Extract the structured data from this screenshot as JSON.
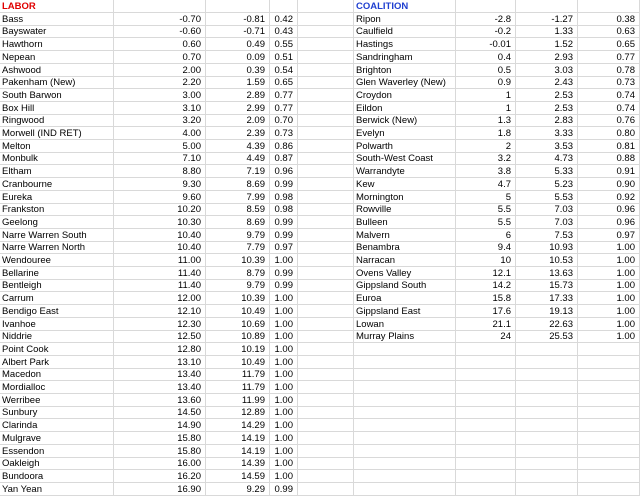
{
  "colors": {
    "labor_header": "#e00000",
    "coalition_header": "#1f3fd0",
    "grid": "#d9d9d9"
  },
  "labor": {
    "header": "LABOR",
    "rows": [
      [
        "Bass",
        "-0.70",
        "-0.81",
        "0.42"
      ],
      [
        "Bayswater",
        "-0.60",
        "-0.71",
        "0.43"
      ],
      [
        "Hawthorn",
        "0.60",
        "0.49",
        "0.55"
      ],
      [
        "Nepean",
        "0.70",
        "0.09",
        "0.51"
      ],
      [
        "Ashwood",
        "2.00",
        "0.39",
        "0.54"
      ],
      [
        "Pakenham (New)",
        "2.20",
        "1.59",
        "0.65"
      ],
      [
        "South Barwon",
        "3.00",
        "2.89",
        "0.77"
      ],
      [
        "Box Hill",
        "3.10",
        "2.99",
        "0.77"
      ],
      [
        "Ringwood",
        "3.20",
        "2.09",
        "0.70"
      ],
      [
        "Morwell (IND RET)",
        "4.00",
        "2.39",
        "0.73"
      ],
      [
        "Melton",
        "5.00",
        "4.39",
        "0.86"
      ],
      [
        "Monbulk",
        "7.10",
        "4.49",
        "0.87"
      ],
      [
        "Eltham",
        "8.80",
        "7.19",
        "0.96"
      ],
      [
        "Cranbourne",
        "9.30",
        "8.69",
        "0.99"
      ],
      [
        "Eureka",
        "9.60",
        "7.99",
        "0.98"
      ],
      [
        "Frankston",
        "10.20",
        "8.59",
        "0.98"
      ],
      [
        "Geelong",
        "10.30",
        "8.69",
        "0.99"
      ],
      [
        "Narre Warren South",
        "10.40",
        "9.79",
        "0.99"
      ],
      [
        "Narre Warren North",
        "10.40",
        "7.79",
        "0.97"
      ],
      [
        "Wendouree",
        "11.00",
        "10.39",
        "1.00"
      ],
      [
        "Bellarine",
        "11.40",
        "8.79",
        "0.99"
      ],
      [
        "Bentleigh",
        "11.40",
        "9.79",
        "0.99"
      ],
      [
        "Carrum",
        "12.00",
        "10.39",
        "1.00"
      ],
      [
        "Bendigo East",
        "12.10",
        "10.49",
        "1.00"
      ],
      [
        "Ivanhoe",
        "12.30",
        "10.69",
        "1.00"
      ],
      [
        "Niddrie",
        "12.50",
        "10.89",
        "1.00"
      ],
      [
        "Point Cook",
        "12.80",
        "10.19",
        "1.00"
      ],
      [
        "Albert Park",
        "13.10",
        "10.49",
        "1.00"
      ],
      [
        "Macedon",
        "13.40",
        "11.79",
        "1.00"
      ],
      [
        "Mordialloc",
        "13.40",
        "11.79",
        "1.00"
      ],
      [
        "Werribee",
        "13.60",
        "11.99",
        "1.00"
      ],
      [
        "Sunbury",
        "14.50",
        "12.89",
        "1.00"
      ],
      [
        "Clarinda",
        "14.90",
        "14.29",
        "1.00"
      ],
      [
        "Mulgrave",
        "15.80",
        "14.19",
        "1.00"
      ],
      [
        "Essendon",
        "15.80",
        "14.19",
        "1.00"
      ],
      [
        "Oakleigh",
        "16.00",
        "14.39",
        "1.00"
      ],
      [
        "Bundoora",
        "16.20",
        "14.59",
        "1.00"
      ],
      [
        "Yan Yean",
        "16.90",
        "9.29",
        "0.99"
      ]
    ]
  },
  "coalition": {
    "header": "COALITION",
    "rows": [
      [
        "Ripon",
        "-2.8",
        "-1.27",
        "0.38"
      ],
      [
        "Caulfield",
        "-0.2",
        "1.33",
        "0.63"
      ],
      [
        "Hastings",
        "-0.01",
        "1.52",
        "0.65"
      ],
      [
        "Sandringham",
        "0.4",
        "2.93",
        "0.77"
      ],
      [
        "Brighton",
        "0.5",
        "3.03",
        "0.78"
      ],
      [
        "Glen Waverley (New)",
        "0.9",
        "2.43",
        "0.73"
      ],
      [
        "Croydon",
        "1",
        "2.53",
        "0.74"
      ],
      [
        "Eildon",
        "1",
        "2.53",
        "0.74"
      ],
      [
        "Berwick (New)",
        "1.3",
        "2.83",
        "0.76"
      ],
      [
        "Evelyn",
        "1.8",
        "3.33",
        "0.80"
      ],
      [
        "Polwarth",
        "2",
        "3.53",
        "0.81"
      ],
      [
        "South-West Coast",
        "3.2",
        "4.73",
        "0.88"
      ],
      [
        "Warrandyte",
        "3.8",
        "5.33",
        "0.91"
      ],
      [
        "Kew",
        "4.7",
        "5.23",
        "0.90"
      ],
      [
        "Mornington",
        "5",
        "5.53",
        "0.92"
      ],
      [
        "Rowville",
        "5.5",
        "7.03",
        "0.96"
      ],
      [
        "Bulleen",
        "5.5",
        "7.03",
        "0.96"
      ],
      [
        "Malvern",
        "6",
        "7.53",
        "0.97"
      ],
      [
        "Benambra",
        "9.4",
        "10.93",
        "1.00"
      ],
      [
        "Narracan",
        "10",
        "10.53",
        "1.00"
      ],
      [
        "Ovens Valley",
        "12.1",
        "13.63",
        "1.00"
      ],
      [
        "Gippsland South",
        "14.2",
        "15.73",
        "1.00"
      ],
      [
        "Euroa",
        "15.8",
        "17.33",
        "1.00"
      ],
      [
        "Gippsland East",
        "17.6",
        "19.13",
        "1.00"
      ],
      [
        "Lowan",
        "21.1",
        "22.63",
        "1.00"
      ],
      [
        "Murray Plains",
        "24",
        "25.53",
        "1.00"
      ]
    ]
  }
}
